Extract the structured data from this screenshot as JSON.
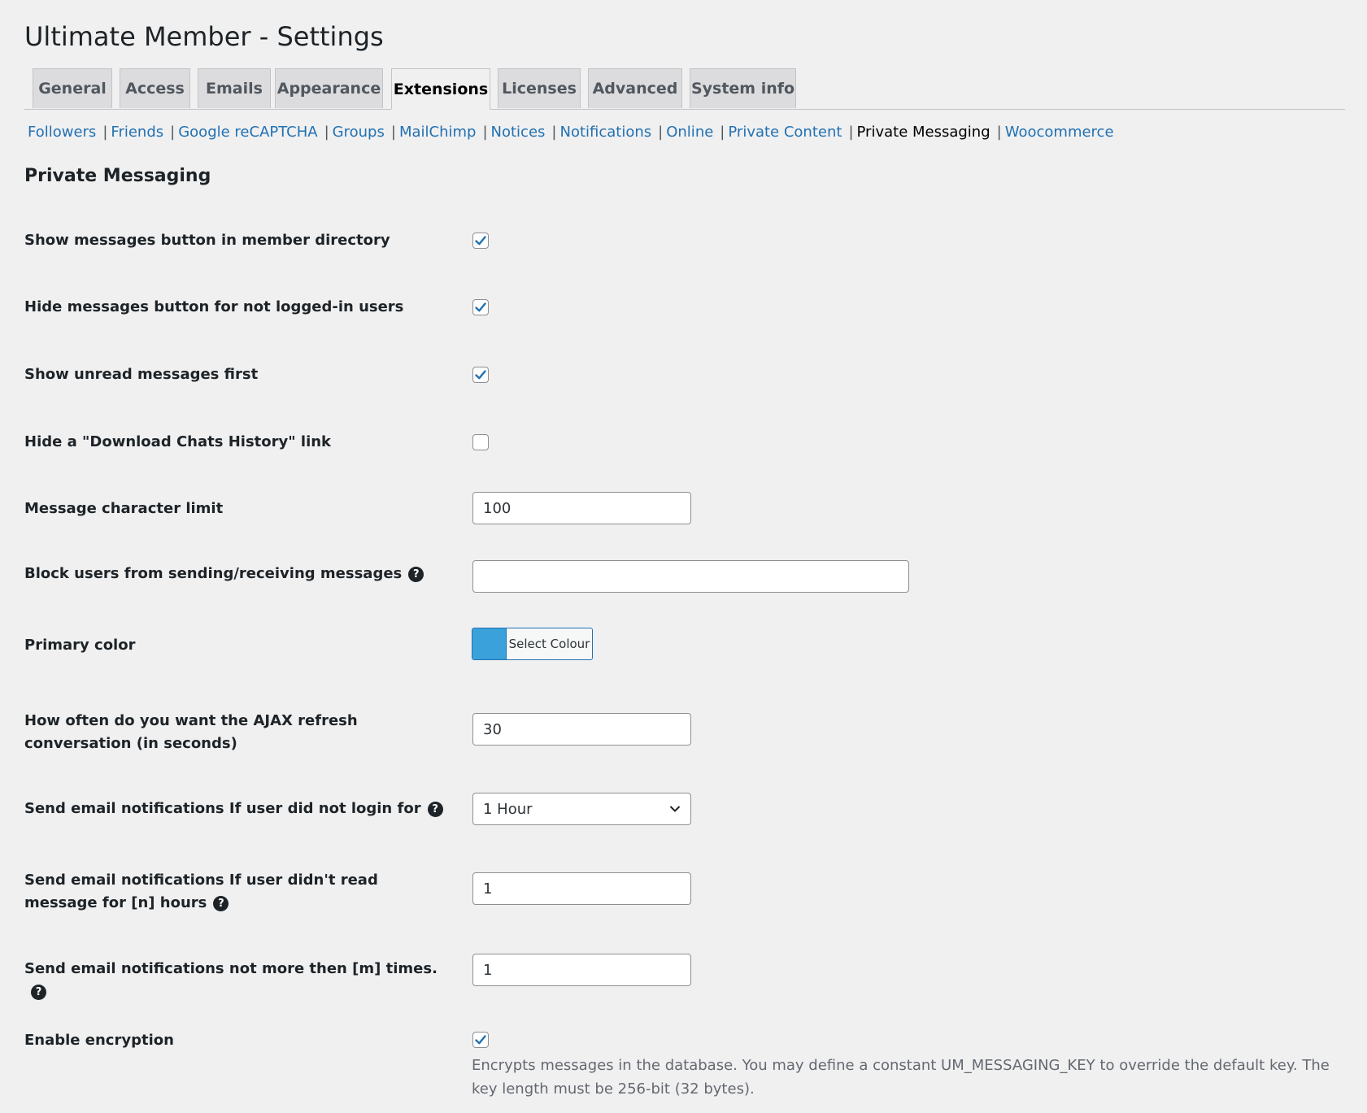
{
  "page": {
    "title": "Ultimate Member - Settings"
  },
  "tabs": [
    {
      "label": "General"
    },
    {
      "label": "Access"
    },
    {
      "label": "Emails"
    },
    {
      "label": "Appearance"
    },
    {
      "label": "Extensions",
      "active": true
    },
    {
      "label": "Licenses"
    },
    {
      "label": "Advanced"
    },
    {
      "label": "System info"
    }
  ],
  "subnav": [
    {
      "label": "Followers"
    },
    {
      "label": "Friends"
    },
    {
      "label": "Google reCAPTCHA"
    },
    {
      "label": "Groups"
    },
    {
      "label": "MailChimp"
    },
    {
      "label": "Notices"
    },
    {
      "label": "Notifications"
    },
    {
      "label": "Online"
    },
    {
      "label": "Private Content"
    },
    {
      "label": "Private Messaging",
      "current": true
    },
    {
      "label": "Woocommerce"
    }
  ],
  "subnav_separator": "|",
  "section": {
    "title": "Private Messaging"
  },
  "fields": {
    "show_messages_button": {
      "label": "Show messages button in member directory",
      "checked": true
    },
    "hide_messages_button": {
      "label": "Hide messages button for not logged-in users",
      "checked": true
    },
    "show_unread_first": {
      "label": "Show unread messages first",
      "checked": true
    },
    "hide_download_link": {
      "label": "Hide a \"Download Chats History\" link",
      "checked": false
    },
    "char_limit": {
      "label": "Message character limit",
      "value": "100"
    },
    "block_users": {
      "label": "Block users from sending/receiving messages",
      "value": ""
    },
    "primary_color": {
      "label": "Primary color",
      "button_label": "Select Colour",
      "color": "#3ba1da"
    },
    "ajax_refresh": {
      "label": "How often do you want the AJAX refresh conversation (in seconds)",
      "value": "30"
    },
    "notify_not_login": {
      "label": "Send email notifications If user did not login for",
      "value": "1 Hour"
    },
    "notify_not_read": {
      "label": "Send email notifications If user didn't read message for [n] hours",
      "value": "1"
    },
    "notify_max_times": {
      "label": "Send email notifications not more then [m] times.",
      "value": "1"
    },
    "enable_encryption": {
      "label": "Enable encryption",
      "checked": true,
      "description": "Encrypts messages in the database. You may define a constant UM_MESSAGING_KEY to override the default key. The key length must be 256-bit (32 bytes)."
    }
  },
  "help_icon_glyph": "?",
  "colors": {
    "link": "#2271b1",
    "checkmark": "#2271b1",
    "background": "#f0f0f1"
  }
}
